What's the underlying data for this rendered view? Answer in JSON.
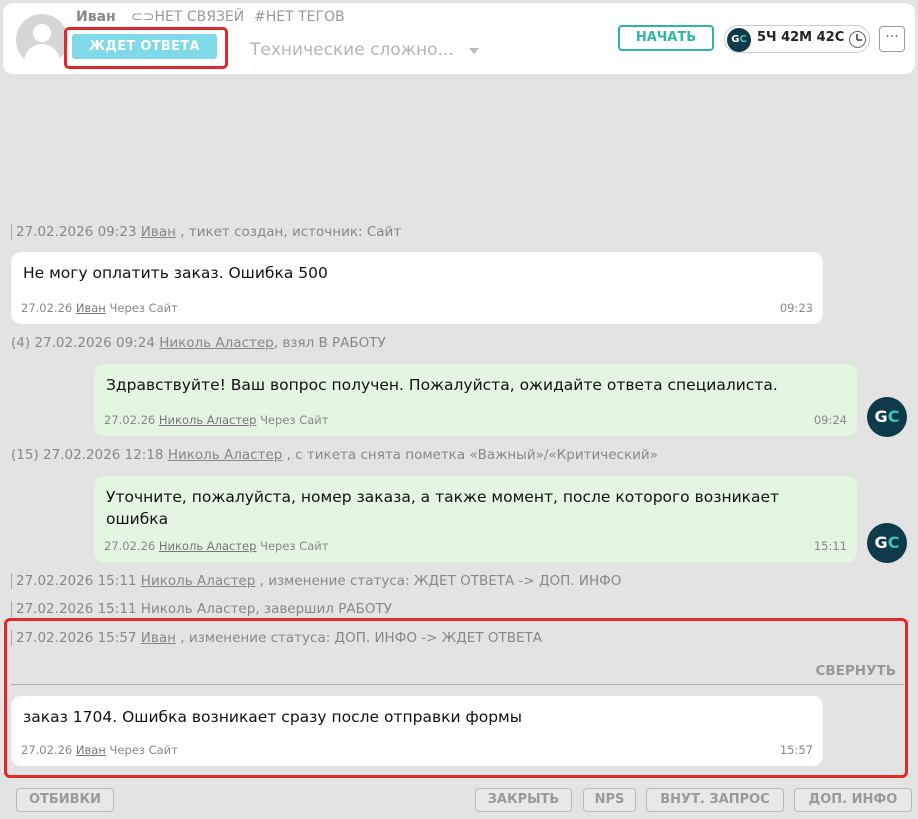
{
  "header": {
    "customer_name": "Иван",
    "links_label": "НЕТ СВЯЗЕЙ",
    "tags_label": "#НЕТ ТЕГОВ",
    "status": "ЖДЕТ ОТВЕТА",
    "category": "Технические сложно...",
    "start_label": "НАЧАТЬ",
    "timer_logo_g": "G",
    "timer_logo_c": "C",
    "timer": "5Ч 42М 42С",
    "more_label": "···",
    "colors": {
      "status": "#7fd9e8",
      "accent": "#2fb5a6",
      "highlight": "#e0282d"
    }
  },
  "feed": {
    "events": [
      {
        "date": "27.02.2026 09:23",
        "user": "Иван",
        "text": ", тикет создан, источник: Сайт"
      },
      {
        "prefix": "(4)",
        "date": "27.02.2026 09:24",
        "user": "Николь Аластер",
        "text": ", взял В РАБОТУ"
      },
      {
        "prefix": "(15)",
        "date": "27.02.2026 12:18",
        "user": "Николь Аластер",
        "text": ", с тикета снята пометка «Важный»/«Критический»"
      },
      {
        "date": "27.02.2026 15:11",
        "user": "Николь Аластер",
        "text": ", изменение статуса: ЖДЕТ ОТВЕТА -> ДОП. ИНФО"
      },
      {
        "date": "27.02.2026 15:11",
        "user": "Николь Аластер",
        "text": ", завершил РАБОТУ"
      },
      {
        "date": "27.02.2026 15:57",
        "user": "Иван",
        "text": ", изменение статуса: ДОП. ИНФО -> ЖДЕТ ОТВЕТА"
      }
    ],
    "messages": [
      {
        "text": "Не могу оплатить заказ. Ошибка 500",
        "date": "27.02.26",
        "author": "Иван",
        "via": "Через Сайт",
        "time": "09:23"
      },
      {
        "text": "Здравствуйте! Ваш вопрос получен. Пожалуйста, ожидайте ответа специалиста.",
        "date": "27.02.26",
        "author": "Николь Аластер",
        "via": "Через Сайт",
        "time": "09:24"
      },
      {
        "text": "Уточните, пожалуйста, номер заказа, а также момент, после которого возникает ошибка",
        "date": "27.02.26",
        "author": "Николь Аластер",
        "via": "Через Сайт",
        "time": "15:11"
      },
      {
        "text": "заказ 1704. Ошибка возникает сразу после отправки формы",
        "date": "27.02.26",
        "author": "Иван",
        "via": "Через Сайт",
        "time": "15:57"
      }
    ],
    "agent_logo_g": "G",
    "agent_logo_c": "C",
    "collapse_label": "СВЕРНУТЬ"
  },
  "actions": {
    "templates": "ОТБИВКИ",
    "close": "ЗАКРЫТЬ",
    "nps": "NPS",
    "internal_request": "ВНУТ. ЗАПРОС",
    "extra_info": "ДОП. ИНФО"
  }
}
